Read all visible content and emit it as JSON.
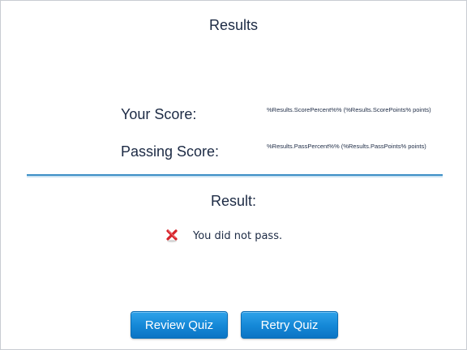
{
  "title": "Results",
  "scores": {
    "your_score_label": "Your Score:",
    "your_score_value": "%Results.ScorePercent%% (%Results.ScorePoints% points)",
    "passing_score_label": "Passing Score:",
    "passing_score_value": "%Results.PassPercent%% (%Results.PassPoints% points)"
  },
  "result": {
    "heading": "Result:",
    "message": "You did not pass.",
    "status_icon": "fail-x-icon",
    "status_color": "#d6232a"
  },
  "buttons": {
    "review_label": "Review Quiz",
    "retry_label": "Retry Quiz"
  },
  "colors": {
    "text": "#1c2a44",
    "divider": "#3d8fc6",
    "button": "#1487d6"
  }
}
